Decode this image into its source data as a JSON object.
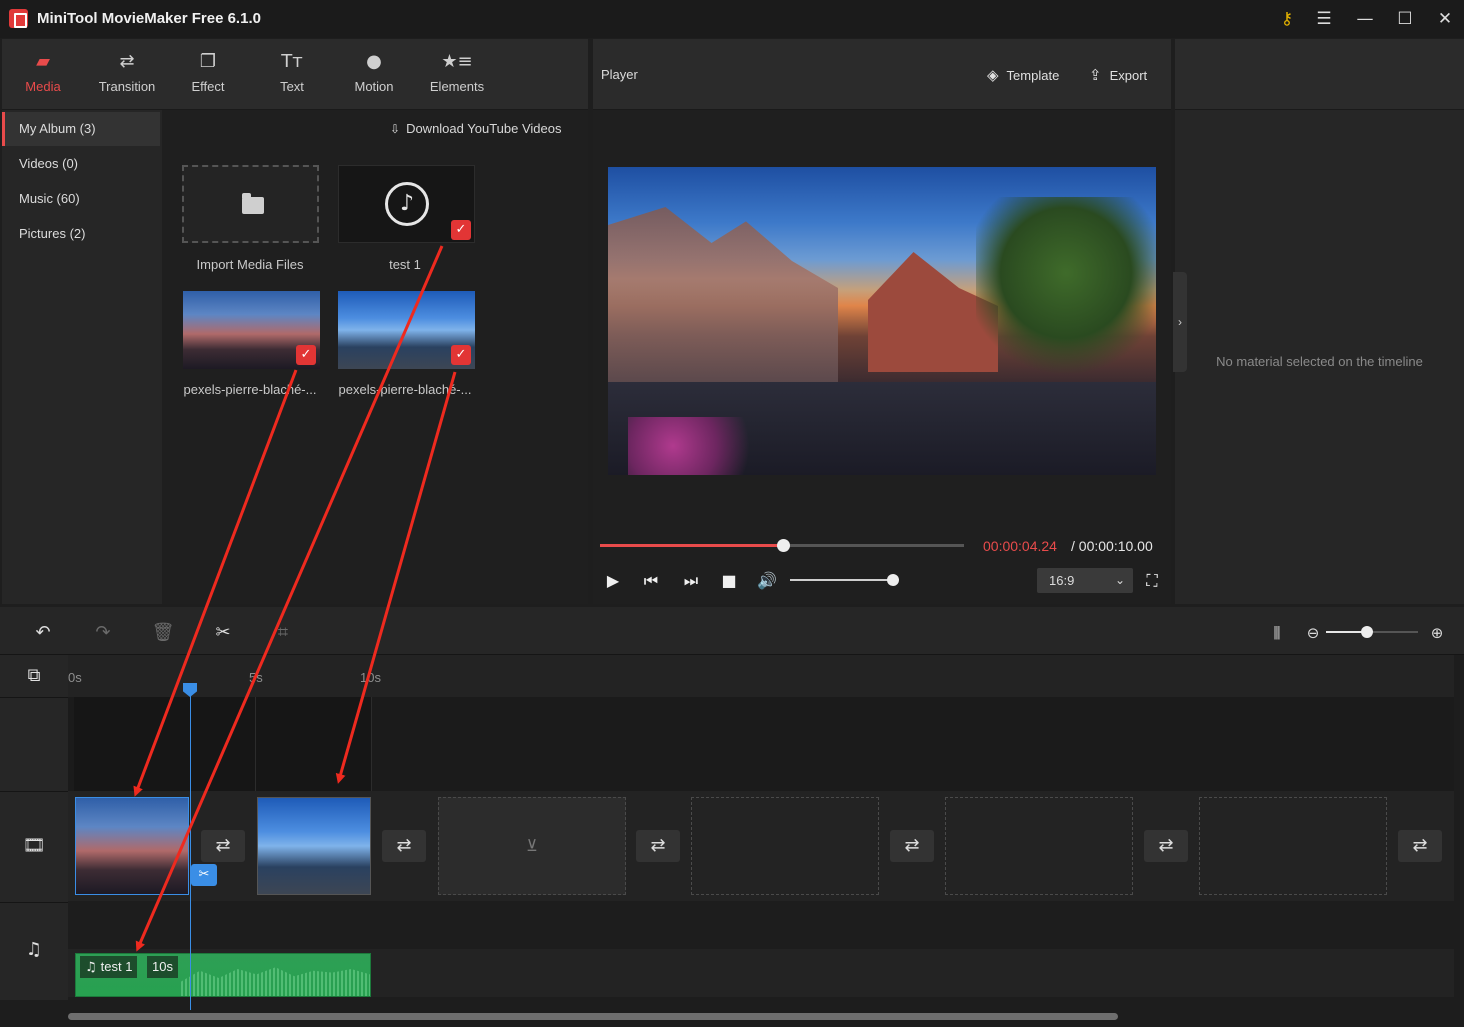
{
  "app": {
    "title": "MiniTool MovieMaker Free 6.1.0"
  },
  "window_controls": {
    "key_icon": "key-icon",
    "menu_icon": "menu-icon",
    "minimize_icon": "minimize-icon",
    "maximize_icon": "maximize-icon",
    "close_icon": "close-icon"
  },
  "tabs": [
    {
      "label": "Media",
      "icon": "folder-icon",
      "active": true
    },
    {
      "label": "Transition",
      "icon": "transition-icon",
      "active": false
    },
    {
      "label": "Effect",
      "icon": "effect-icon",
      "active": false
    },
    {
      "label": "Text",
      "icon": "text-icon",
      "active": false
    },
    {
      "label": "Motion",
      "icon": "motion-icon",
      "active": false
    },
    {
      "label": "Elements",
      "icon": "elements-icon",
      "active": false
    }
  ],
  "album_nav": [
    {
      "label": "My Album (3)",
      "active": true
    },
    {
      "label": "Videos (0)",
      "active": false
    },
    {
      "label": "Music (60)",
      "active": false
    },
    {
      "label": "Pictures (2)",
      "active": false
    }
  ],
  "download_link": "Download YouTube Videos",
  "media_items": [
    {
      "label": "Import Media Files"
    },
    {
      "label": "test 1",
      "checked": true
    },
    {
      "label": "pexels-pierre-blaché-...",
      "checked": true
    },
    {
      "label": "pexels-pierre-blaché-...",
      "checked": true
    }
  ],
  "player": {
    "title": "Player",
    "template_label": "Template",
    "export_label": "Export",
    "time_current": "00:00:04.24",
    "time_total": "/ 00:00:10.00",
    "progress": 0.5,
    "volume": 1.0,
    "aspect_ratio": "16:9"
  },
  "properties": {
    "empty_message": "No material selected on the timeline"
  },
  "timeline": {
    "ruler_labels": [
      "0s",
      "5s",
      "10s"
    ],
    "audio_clip": {
      "name": "test 1",
      "duration": "10s"
    },
    "zoom_level": 0.45
  },
  "colors": {
    "accent": "#e84b4b",
    "playhead": "#3a8ee6",
    "audio_clip": "#2e9f55",
    "annotation_arrow": "#ee2a1f"
  }
}
